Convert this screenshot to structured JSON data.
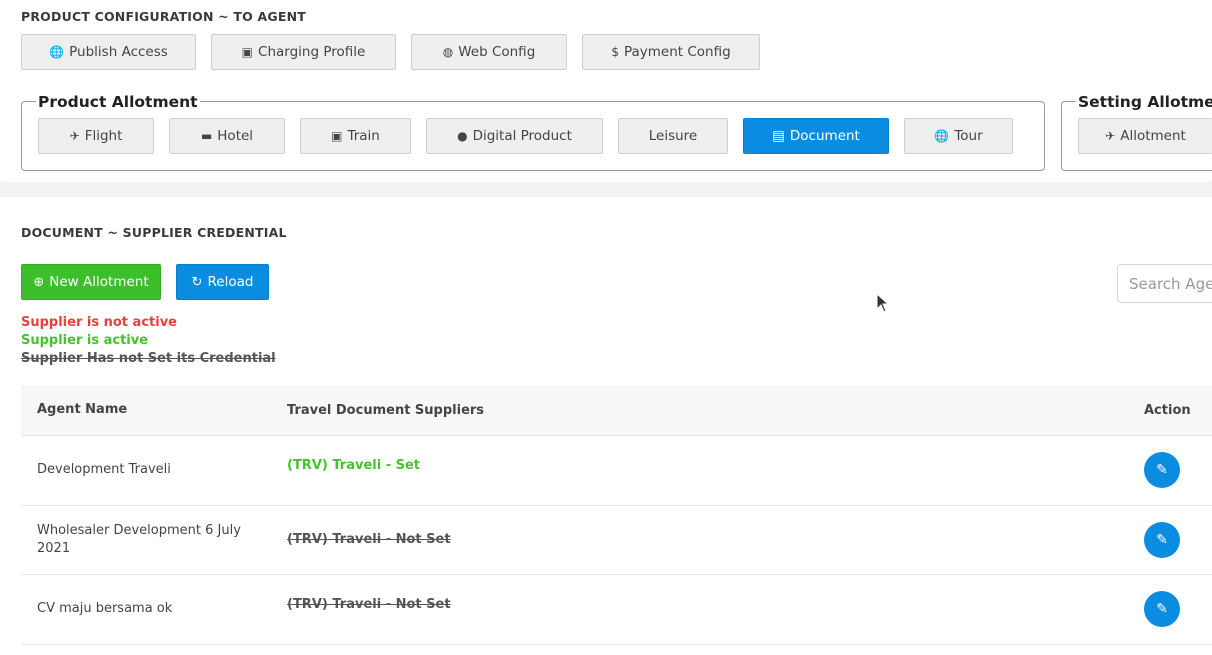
{
  "config": {
    "title": "PRODUCT CONFIGURATION ~ TO AGENT",
    "buttons": [
      {
        "label": "Publish Access",
        "icon": "globe-icon",
        "glyph": "🌐"
      },
      {
        "label": "Charging Profile",
        "icon": "money-icon",
        "glyph": "▣"
      },
      {
        "label": "Web Config",
        "icon": "globe-alt-icon",
        "glyph": "◍"
      },
      {
        "label": "Payment Config",
        "icon": "dollar-icon",
        "glyph": "$"
      }
    ]
  },
  "product_allotment": {
    "legend": "Product Allotment",
    "items": [
      {
        "label": "Flight",
        "icon": "plane-icon",
        "glyph": "✈"
      },
      {
        "label": "Hotel",
        "icon": "bed-icon",
        "glyph": "▬"
      },
      {
        "label": "Train",
        "icon": "train-icon",
        "glyph": "▣"
      },
      {
        "label": "Digital Product",
        "icon": "digital-icon",
        "glyph": "●"
      },
      {
        "label": "Leisure",
        "icon": "",
        "glyph": ""
      },
      {
        "label": "Document",
        "icon": "document-icon",
        "glyph": "▤",
        "active": true
      },
      {
        "label": "Tour",
        "icon": "globe-icon",
        "glyph": "🌐"
      }
    ]
  },
  "setting_allotment": {
    "legend": "Setting Allotmen",
    "items": [
      {
        "label": "Allotment",
        "icon": "plane-icon",
        "glyph": "✈"
      }
    ]
  },
  "document": {
    "title": "DOCUMENT ~ SUPPLIER CREDENTIAL",
    "new_button": "New Allotment",
    "reload_button": "Reload",
    "search_placeholder": "Search Age",
    "legend_lines": {
      "inactive": "Supplier is not active",
      "active": "Supplier is active",
      "not_set": "Supplier Has not Set its Credential"
    },
    "colors": {
      "inactive": "#e8413a",
      "active": "#49c02f",
      "not_set": "#555555"
    },
    "table": {
      "headers": [
        "Agent Name",
        "Travel Document Suppliers",
        "Action"
      ],
      "rows": [
        {
          "agent": "Development Traveli",
          "supplier": "(TRV) Traveli - Set",
          "status": "active"
        },
        {
          "agent": "Wholesaler Development 6 July 2021",
          "supplier": "(TRV) Traveli - Not Set",
          "status": "not_set"
        },
        {
          "agent": "CV maju bersama ok",
          "supplier": "(TRV) Traveli - Not Set",
          "status": "not_set"
        }
      ]
    }
  }
}
